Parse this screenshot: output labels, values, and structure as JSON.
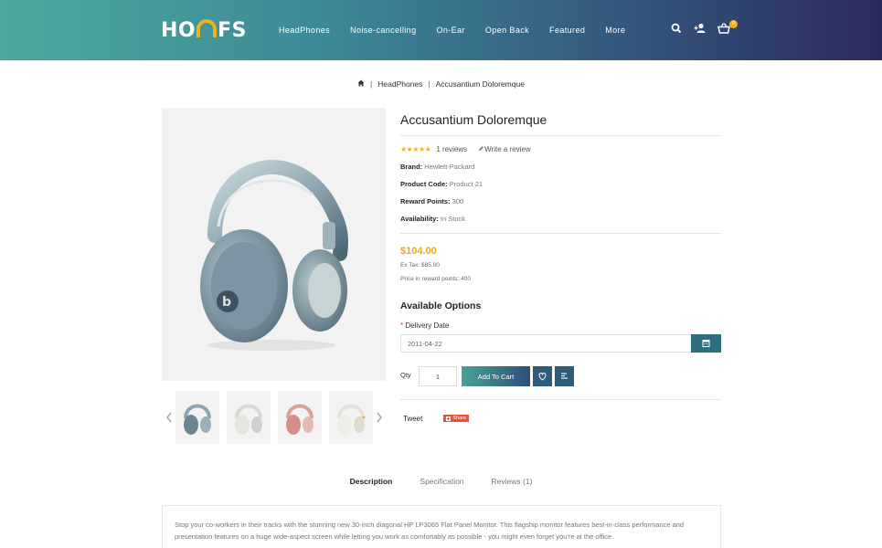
{
  "brand": {
    "logo_left": "HO",
    "logo_right": "FS"
  },
  "nav": {
    "items": [
      "HeadPhones",
      "Noise-cancelling",
      "On-Ear",
      "Open Back",
      "Featured",
      "More"
    ]
  },
  "header_icons": {
    "search": "search-icon",
    "account": "add-user-icon",
    "cart": "basket-icon",
    "cart_count": "0"
  },
  "breadcrumb": {
    "home": "home-icon",
    "category": "HeadPhones",
    "current": "Accusantium Doloremque"
  },
  "product": {
    "title": "Accusantium Doloremque",
    "rating_stars": 5,
    "reviews_text": "1 reviews",
    "write_review": "Write a review",
    "brand_label": "Brand:",
    "brand_value": "Hewlett-Packard",
    "code_label": "Product Code:",
    "code_value": "Product 21",
    "points_label": "Reward Points:",
    "points_value": "300",
    "avail_label": "Availability:",
    "avail_value": "In Stock",
    "price": "$104.00",
    "ex_tax": "Ex Tax: $85.00",
    "reward_price": "Price in reward points: 400"
  },
  "options": {
    "title": "Available Options",
    "delivery_label": "Delivery Date",
    "required_mark": "*",
    "delivery_value": "2011-04-22"
  },
  "cart": {
    "qty_label": "Qty",
    "qty_value": "1",
    "add_to_cart": "Add To Cart"
  },
  "social": {
    "tweet": "Tweet",
    "share": "Share"
  },
  "tabs": [
    "Description",
    "Specification",
    "Reviews (1)"
  ],
  "description": "Stop your co-workers in their tracks with the stunning new 30-inch diagonal HP LP3065 Flat Panel Monitor. This flagship monitor features best-in-class performance and presentation features on a huge wide-aspect screen while letting you work as comfortably as possible - you might even forget you're at the office.",
  "colors": {
    "accent": "#f1b21a",
    "button": "#2f6e7d",
    "header_start": "#4aa99a",
    "header_end": "#2b2a5e"
  }
}
